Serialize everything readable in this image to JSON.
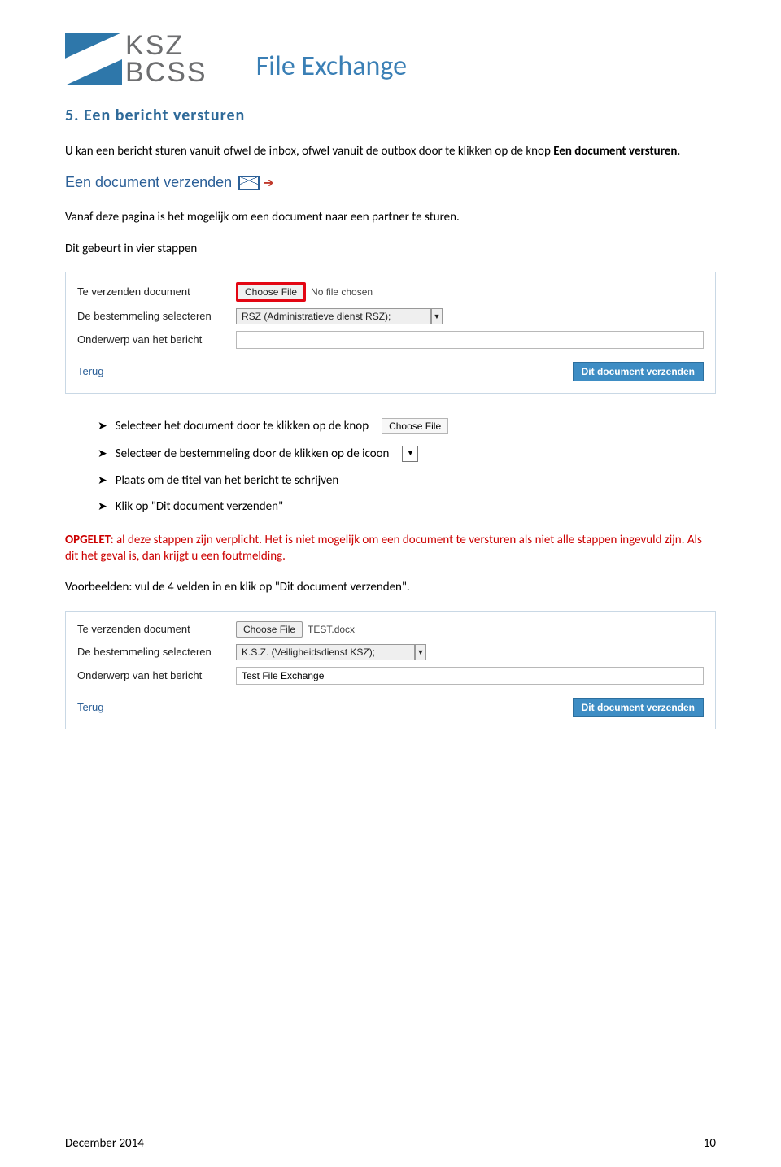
{
  "logo": {
    "line1": "KSZ",
    "line2": "BCSS"
  },
  "doc_title": "File Exchange",
  "section_heading": "5. Een bericht versturen",
  "intro_1a": "U kan een bericht sturen vanuit ofwel de inbox, ofwel vanuit de outbox door te klikken op de knop ",
  "intro_1b": "Een document versturen",
  "intro_1c": ".",
  "send_link_text": "Een document verzenden",
  "para_after_link": "Vanaf deze pagina is het mogelijk om een document naar een partner te sturen.",
  "para_steps": "Dit gebeurt in vier stappen",
  "form1": {
    "row1_label": "Te verzenden document",
    "choose": "Choose File",
    "no_file": "No file chosen",
    "row2_label": "De bestemmeling selecteren",
    "select_value": "RSZ (Administratieve dienst RSZ);",
    "row3_label": "Onderwerp van het bericht",
    "subject_value": "",
    "terug": "Terug",
    "submit": "Dit document verzenden"
  },
  "bullets": {
    "b1": "Selecteer het document door te klikken op de knop",
    "b1_btn": "Choose File",
    "b2": "Selecteer de bestemmeling door de klikken op de icoon",
    "b3": "Plaats om de titel van het bericht te schrijven",
    "b4": "Klik op \"Dit document verzenden\""
  },
  "warn_prefix": "OPGELET:",
  "warn_rest": " al deze stappen zijn verplicht. Het is niet mogelijk om een document te versturen als niet alle stappen ingevuld zijn. Als dit het geval is, dan krijgt u een foutmelding.",
  "examples_line": "Voorbeelden: vul de 4 velden in en klik op \"Dit document verzenden\".",
  "form2": {
    "row1_label": "Te verzenden document",
    "choose": "Choose File",
    "file_name": "TEST.docx",
    "row2_label": "De bestemmeling selecteren",
    "select_value": "K.S.Z. (Veiligheidsdienst KSZ);",
    "row3_label": "Onderwerp van het bericht",
    "subject_value": "Test File Exchange",
    "terug": "Terug",
    "submit": "Dit document verzenden"
  },
  "footer_left": "December 2014",
  "footer_right": "10"
}
